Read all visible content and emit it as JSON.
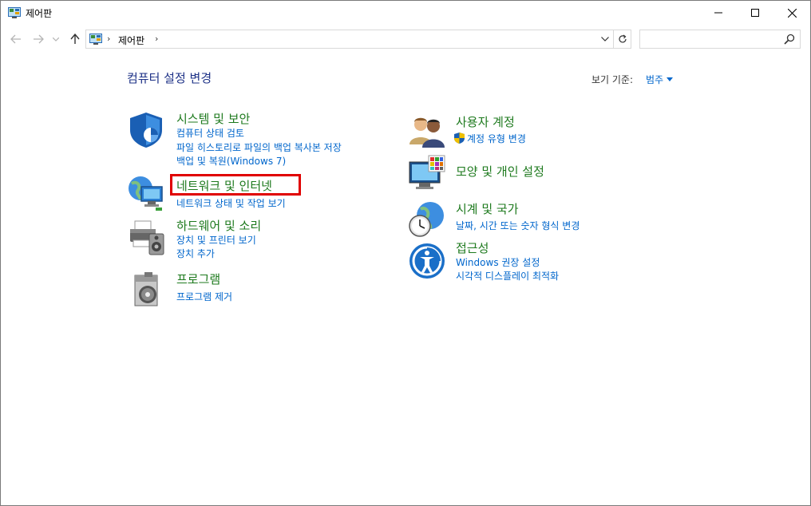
{
  "window": {
    "title": "제어판",
    "minimize_symbol": "—",
    "maximize_symbol": "□",
    "close_symbol": "✕"
  },
  "address_bar": {
    "crumb": "제어판",
    "separator": "›",
    "search_placeholder": ""
  },
  "content": {
    "heading": "컴퓨터 설정 변경",
    "view_by_label": "보기 기준:",
    "view_by_value": "범주"
  },
  "categories": {
    "system_security": {
      "title": "시스템 및 보안",
      "icon": "shield-icon",
      "links": [
        "컴퓨터 상태 검토",
        "파일 히스토리로 파일의 백업 복사본 저장",
        "백업 및 복원(Windows 7)"
      ]
    },
    "network": {
      "title": "네트워크 및 인터넷",
      "icon": "network-globe-icon",
      "links": [
        "네트워크 상태 및 작업 보기"
      ]
    },
    "hardware": {
      "title": "하드웨어 및 소리",
      "icon": "printer-speaker-icon",
      "links": [
        "장치 및 프린터 보기",
        "장치 추가"
      ]
    },
    "programs": {
      "title": "프로그램",
      "icon": "program-disc-icon",
      "links": [
        "프로그램 제거"
      ]
    },
    "user_accounts": {
      "title": "사용자 계정",
      "icon": "users-icon",
      "links": [
        "계정 유형 변경"
      ]
    },
    "appearance": {
      "title": "모양 및 개인 설정",
      "icon": "monitor-palette-icon",
      "links": []
    },
    "clock_region": {
      "title": "시계 및 국가",
      "icon": "clock-globe-icon",
      "links": [
        "날짜, 시간 또는 숫자 형식 변경"
      ]
    },
    "ease_access": {
      "title": "접근성",
      "icon": "ease-of-access-icon",
      "links": [
        "Windows 권장 설정",
        "시각적 디스플레이 최적화"
      ]
    }
  },
  "colors": {
    "category_title": "#1e7a1e",
    "link": "#0066cc",
    "heading": "#1e3287",
    "highlight": "#e00000"
  }
}
